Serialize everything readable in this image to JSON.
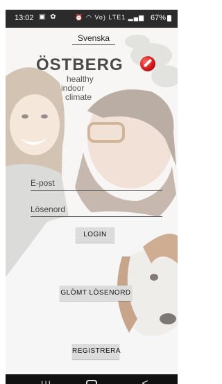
{
  "status_bar": {
    "time": "13:02",
    "left_icons": [
      "notification-icon",
      "teams-icon"
    ],
    "right_icons": [
      "alarm-icon",
      "wifi-icon",
      "signal-icon"
    ],
    "network_label": "Vo) LTE1",
    "battery": "67%"
  },
  "language": {
    "label": "Svenska"
  },
  "logo": {
    "wordmark": "ÖSTBERG",
    "tagline_1": "healthy",
    "tagline_2": "indoor",
    "tagline_3": "climate",
    "brand_color": "#d11a1a"
  },
  "form": {
    "email_placeholder": "E-post",
    "password_placeholder": "Lösenord",
    "login_label": "LOGIN",
    "forgot_label": "GLÖMT LÖSENORD",
    "register_label": "REGISTRERA"
  },
  "nav_bar": {
    "recents_glyph": "III",
    "home_glyph": "",
    "back_glyph": "<"
  }
}
